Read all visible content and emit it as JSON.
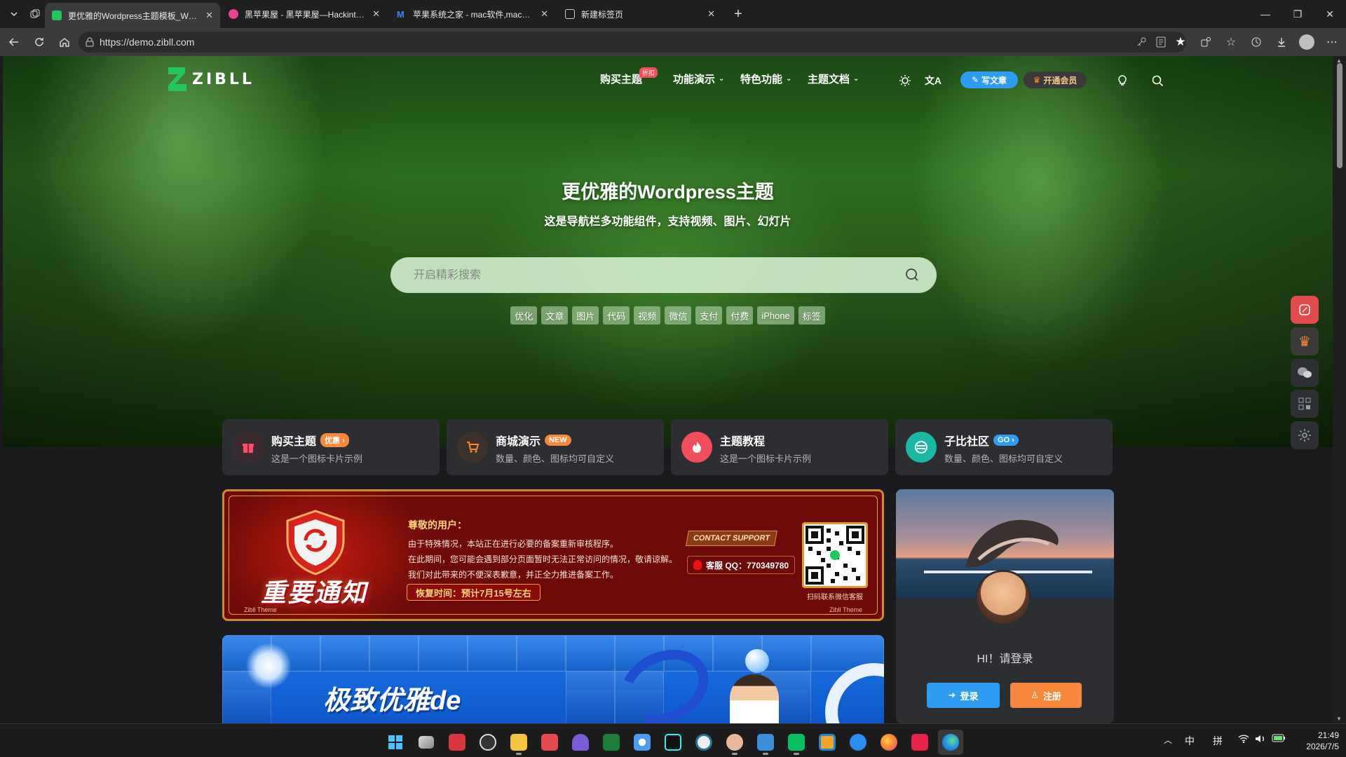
{
  "browser": {
    "tabs": [
      {
        "title": "更优雅的Wordpress主题模板_WP主题",
        "color": "#22c55e"
      },
      {
        "title": "黑苹果屋 - 黑苹果屋—Hackintosh黑苹果",
        "color": "#e84393"
      },
      {
        "title": "苹果系统之家 - mac软件,macOS镜像",
        "color": "#3b82f6"
      },
      {
        "title": "新建标签页",
        "color": "#cccccc"
      }
    ],
    "url": "https://demo.zibll.com"
  },
  "site": {
    "logo": "ZIBLL",
    "nav": {
      "buy": "购买主题",
      "hot_badge": "折扣",
      "features_demo": "功能演示",
      "special": "特色功能",
      "docs": "主题文档",
      "write": "写文章",
      "vip": "开通会员"
    },
    "hero": {
      "title": "更优雅的Wordpress主题",
      "subtitle": "这是导航栏多功能组件，支持视频、图片、幻灯片",
      "search_placeholder": "开启精彩搜索",
      "tags": [
        "优化",
        "文章",
        "图片",
        "代码",
        "视频",
        "微信",
        "支付",
        "付费",
        "iPhone",
        "标签"
      ]
    },
    "cards": [
      {
        "title": "购买主题",
        "badge": "优惠 ›",
        "badge_color": "#f7873a",
        "desc": "这是一个图标卡片示例",
        "icon_color": "#ff4d6d",
        "icon_bg": "#3d2a2e"
      },
      {
        "title": "商城演示",
        "badge": "NEW",
        "badge_color": "#f7873a",
        "desc": "数量、颜色、图标均可自定义",
        "icon_color": "#f7873a",
        "icon_bg": "#3d322a"
      },
      {
        "title": "主题教程",
        "badge": "",
        "badge_color": "",
        "desc": "这是一个图标卡片示例",
        "icon_color": "#ffffff",
        "icon_bg": "#f04e5b"
      },
      {
        "title": "子比社区",
        "badge": "GO ›",
        "badge_color": "#2e9cf3",
        "desc": "数量、颜色、图标均可自定义",
        "icon_color": "#ffffff",
        "icon_bg": "#1cb8a6"
      }
    ],
    "notice": {
      "big_title": "重要通知",
      "heading": "尊敬的用户：",
      "lines": [
        "由于特殊情况，本站正在进行必要的备案重新审核程序。",
        "在此期间，您可能会遇到部分页面暂时无法正常访问的情况，敬请谅解。",
        "我们对此带来的不便深表歉意，并正全力推进备案工作。"
      ],
      "restore": "恢复时间：预计7月15号左右",
      "contact": "CONTACT SUPPORT",
      "qq": "客服 QQ：770349780",
      "qr_caption": "扫码联系微信客服",
      "watermark": "Zibll Theme"
    },
    "banner2": {
      "text": "极致优雅de"
    },
    "user": {
      "greeting": "HI！请登录",
      "login": "登录",
      "register": "注册"
    }
  },
  "taskbar": {
    "ime1": "中",
    "ime2": "拼",
    "time": "21:49",
    "date": "2026/7/5"
  }
}
